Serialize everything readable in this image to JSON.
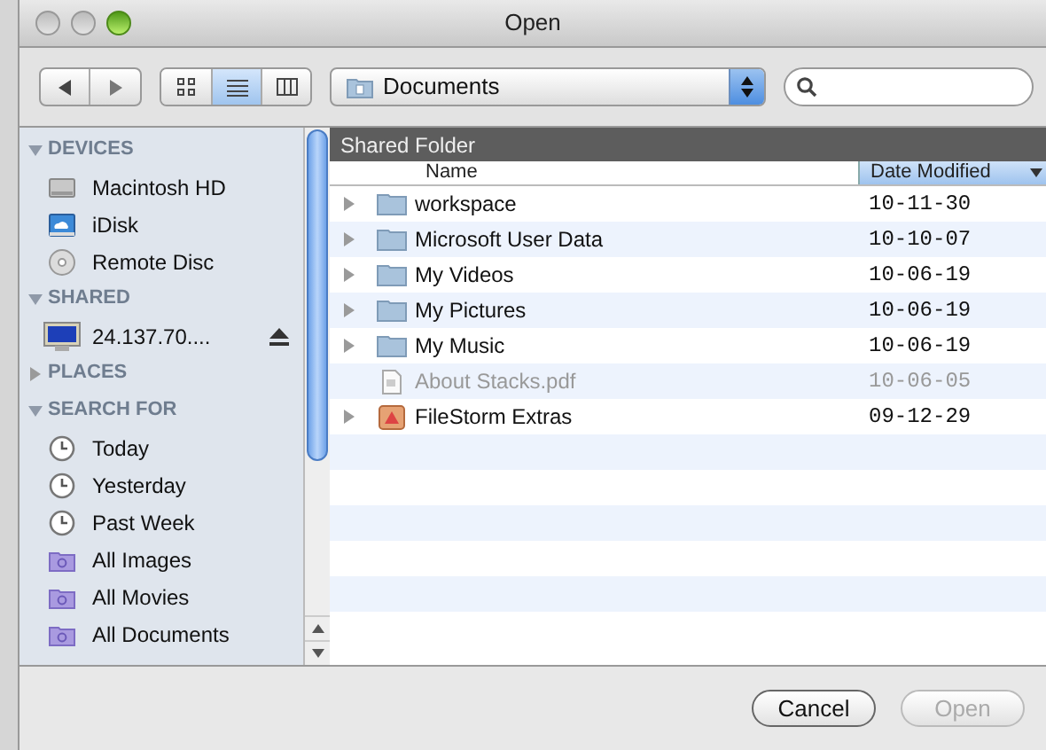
{
  "window": {
    "title": "Open"
  },
  "toolbar": {
    "views": [
      {
        "kind": "icons",
        "selected": false
      },
      {
        "kind": "list",
        "selected": true
      },
      {
        "kind": "columns",
        "selected": false
      }
    ],
    "location": "Documents"
  },
  "sidebar": {
    "sections": [
      {
        "label": "DEVICES",
        "expanded": true,
        "items": [
          {
            "label": "Macintosh HD",
            "kind": "disk"
          },
          {
            "label": "iDisk",
            "kind": "idisk"
          },
          {
            "label": "Remote Disc",
            "kind": "disc"
          }
        ]
      },
      {
        "label": "SHARED",
        "expanded": true,
        "items": [
          {
            "label": "24.137.70....",
            "kind": "monitor",
            "ejectable": true
          }
        ]
      },
      {
        "label": "PLACES",
        "expanded": false
      },
      {
        "label": "SEARCH FOR",
        "expanded": true,
        "items": [
          {
            "label": "Today",
            "kind": "clock"
          },
          {
            "label": "Yesterday",
            "kind": "clock"
          },
          {
            "label": "Past Week",
            "kind": "clock"
          },
          {
            "label": "All Images",
            "kind": "smartfolder"
          },
          {
            "label": "All Movies",
            "kind": "smartfolder"
          },
          {
            "label": "All Documents",
            "kind": "smartfolder"
          }
        ]
      }
    ]
  },
  "browser": {
    "title": "Shared Folder",
    "columns": [
      {
        "label": "Name",
        "selected": false
      },
      {
        "label": "Date Modified",
        "selected": true
      }
    ],
    "rows": [
      {
        "name": "workspace",
        "date": "10-11-30",
        "kind": "folder",
        "disabled": false
      },
      {
        "name": "Microsoft User Data",
        "date": "10-10-07",
        "kind": "folder",
        "disabled": false
      },
      {
        "name": "My Videos",
        "date": "10-06-19",
        "kind": "folder",
        "disabled": false
      },
      {
        "name": "My Pictures",
        "date": "10-06-19",
        "kind": "folder",
        "disabled": false
      },
      {
        "name": "My Music",
        "date": "10-06-19",
        "kind": "folder",
        "disabled": false
      },
      {
        "name": "About Stacks.pdf",
        "date": "10-06-05",
        "kind": "document",
        "disabled": true
      },
      {
        "name": "FileStorm Extras",
        "date": "09-12-29",
        "kind": "app",
        "disabled": false
      }
    ]
  },
  "buttons": [
    {
      "label": "Cancel",
      "disabled": false
    },
    {
      "label": "Open",
      "disabled": true
    }
  ]
}
